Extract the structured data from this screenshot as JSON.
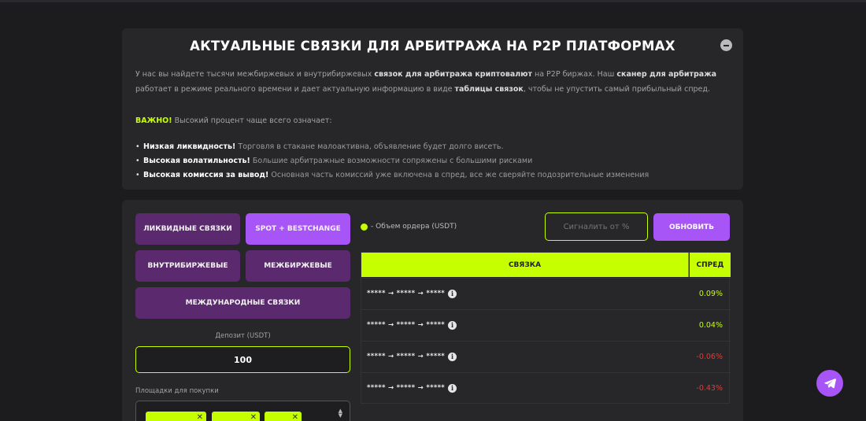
{
  "info": {
    "title": "АКТУАЛЬНЫЕ СВЯЗКИ ДЛЯ АРБИТРАЖА НА P2P ПЛАТФОРМАХ",
    "p_1": "У нас вы найдете тысячи межбиржевых и внутрибиржевых ",
    "p_b1": "связок для арбитража криптовалют",
    "p_2": " на P2P биржах. Наш ",
    "p_b2": "сканер для арбитража",
    "p_3": " работает в режиме реального времени и дает актуальную информацию в виде ",
    "p_b3": "таблицы связок",
    "p_4": ", чтобы не упустить самый прибыльный спред.",
    "important_label": "ВАЖНО!",
    "important_text": " Высокий процент чаще всего означает:",
    "bullets": [
      {
        "bold": "Низкая ликвидность!",
        "text": " Торговля в стакане малоактивна, объявление будет долго висеть."
      },
      {
        "bold": "Высокая волатильность!",
        "text": " Большие арбитражные возможности сопряжены с большими рисками"
      },
      {
        "bold": "Высокая комиссия за вывод!",
        "text": " Основная часть комиссий уже включена в спред, все же сверяйте подозрительные изменения"
      }
    ]
  },
  "filters": {
    "liquid": "ЛИКВИДНЫЕ СВЯЗКИ",
    "spot": "SPOT + BESTCHANGE",
    "intra": "ВНУТРИБИРЖЕВЫЕ",
    "inter": "МЕЖБИРЖЕВЫЕ",
    "intl": "МЕЖДУНАРОДНЫЕ СВЯЗКИ"
  },
  "deposit": {
    "label": "Депозит (USDT)",
    "value": "100"
  },
  "platforms": {
    "label": "Площадки для покупки"
  },
  "legend": "- Объем ордера (USDT)",
  "signal": {
    "placeholder": "Сигналить от %"
  },
  "refresh_label": "ОБНОВИТЬ",
  "table": {
    "col_pair": "СВЯЗКА",
    "col_spread": "СПРЕД",
    "rows": [
      {
        "pair": "***** → ***** → *****",
        "spread": "0.09%"
      },
      {
        "pair": "***** → ***** → *****",
        "spread": "0.04%"
      },
      {
        "pair": "***** → ***** → *****",
        "spread": "-0.06%"
      },
      {
        "pair": "***** → ***** → *****",
        "spread": "-0.43%"
      }
    ]
  },
  "colors": {
    "accent": "#c6ff00",
    "purple": "#a855f7",
    "purple_dark": "#5b2a6e",
    "negative": "#e53935"
  },
  "icons": {
    "collapse": "minus-circle-icon",
    "info": "info-icon",
    "telegram": "telegram-icon"
  }
}
